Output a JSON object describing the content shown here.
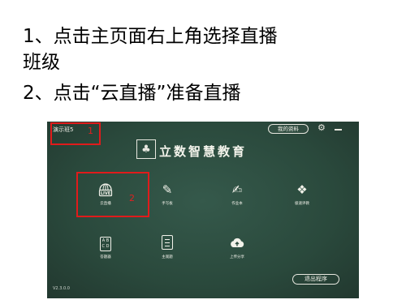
{
  "instructions": {
    "step1_line1": "1、点击主页面右上角选择直播",
    "step1_line2": "班级",
    "step2": "2、点击“云直播”准备直播"
  },
  "app": {
    "class_name": "演示班5",
    "profile_button": "我的资料",
    "brand": "立数智慧教育",
    "version": "V2.3.0.0",
    "exit_button": "退出程序",
    "tiles": [
      {
        "label": "云直播",
        "icon": "live-globe-icon"
      },
      {
        "label": "手写板",
        "icon": "pen-icon"
      },
      {
        "label": "作业本",
        "icon": "notebook-icon"
      },
      {
        "label": "极速评教",
        "icon": "evaluation-icon"
      },
      {
        "label": "答题器",
        "icon": "abcd-icon"
      },
      {
        "label": "主观题",
        "icon": "document-icon"
      },
      {
        "label": "上传分享",
        "icon": "cloud-upload-icon"
      }
    ]
  },
  "annotations": {
    "box1": "1",
    "box2": "2"
  },
  "colors": {
    "board": "#2a493c",
    "highlight": "#e01b1b",
    "chalk": "#f2f2ea"
  }
}
